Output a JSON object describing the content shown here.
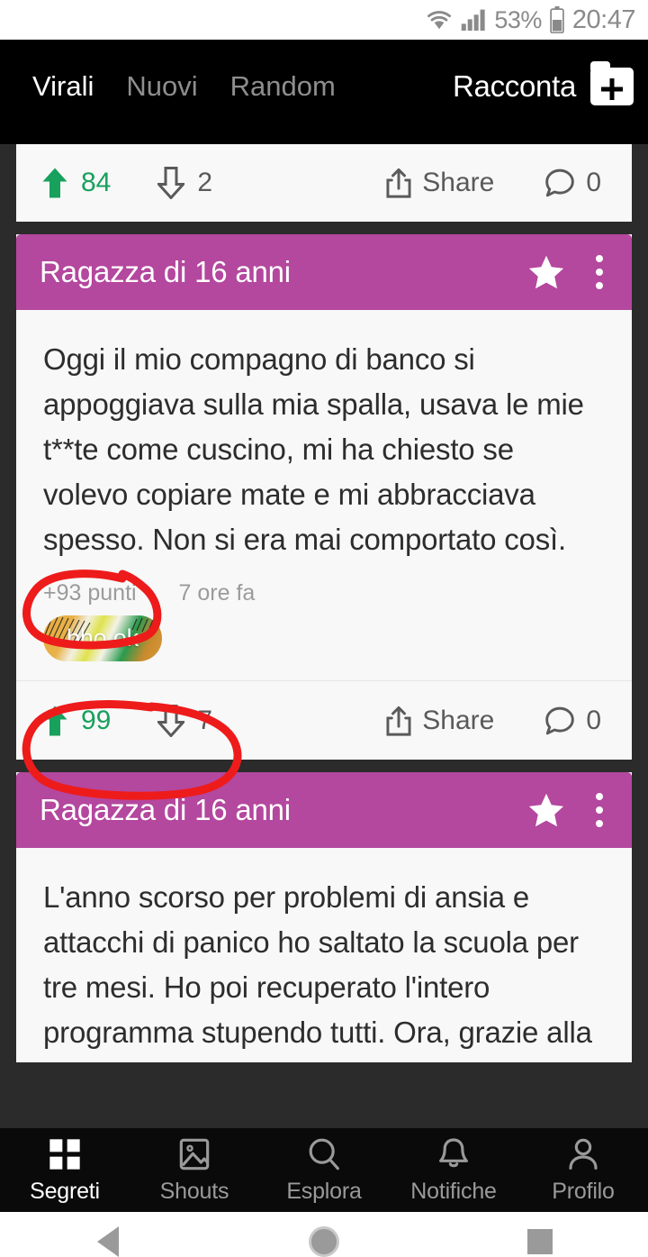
{
  "status_bar": {
    "wifi_icon": "wifi-icon",
    "signal_icon": "cellular-signal-icon",
    "battery_percent": "53%",
    "battery_icon": "battery-icon",
    "clock": "20:47"
  },
  "top_bar": {
    "tabs": [
      {
        "label": "Virali",
        "active": true
      },
      {
        "label": "Nuovi",
        "active": false
      },
      {
        "label": "Random",
        "active": false
      }
    ],
    "compose_label": "Racconta",
    "compose_icon": "folder-plus-icon",
    "indicator_color": "#2b8fee"
  },
  "colors": {
    "header_purple": "#b4479e",
    "upvote_green": "#18a05d",
    "annotation_red": "#ee1b1b",
    "card_background": "#f8f8f8",
    "page_background": "#2b2b2b"
  },
  "feed": {
    "partial_top_post": {
      "upvotes": "84",
      "downvotes": "2",
      "share_label": "Share",
      "comments": "0"
    },
    "posts": [
      {
        "title": "Ragazza di 16 anni",
        "star_icon": "star-icon",
        "menu_icon": "more-vertical-icon",
        "text": "Oggi il mio compagno di banco si appoggiava sulla mia spalla, usava le mie t**te come cuscino, mi ha chiesto se volevo copiare mate e mi abbracciava spesso. Non si era mai comportato così.",
        "points": "+93 punti",
        "time": "7 ore fa",
        "comment_preview": "bho ok",
        "upvotes": "99",
        "downvotes": "7",
        "share_label": "Share",
        "comments": "0"
      },
      {
        "title": "Ragazza di 16 anni",
        "star_icon": "star-icon",
        "menu_icon": "more-vertical-icon",
        "text": "L'anno scorso per problemi di ansia e attacchi di panico ho saltato la scuola per tre mesi. Ho poi recuperato l'intero programma stupendo tutti. Ora, grazie alla"
      }
    ]
  },
  "bottom_nav": {
    "items": [
      {
        "label": "Segreti",
        "icon": "grid-icon",
        "active": true
      },
      {
        "label": "Shouts",
        "icon": "image-icon",
        "active": false
      },
      {
        "label": "Esplora",
        "icon": "search-icon",
        "active": false
      },
      {
        "label": "Notifiche",
        "icon": "bell-icon",
        "active": false
      },
      {
        "label": "Profilo",
        "icon": "person-icon",
        "active": false
      }
    ]
  },
  "system_nav": {
    "back_icon": "back-triangle-icon",
    "home_icon": "home-circle-icon",
    "recents_icon": "recents-square-icon"
  }
}
